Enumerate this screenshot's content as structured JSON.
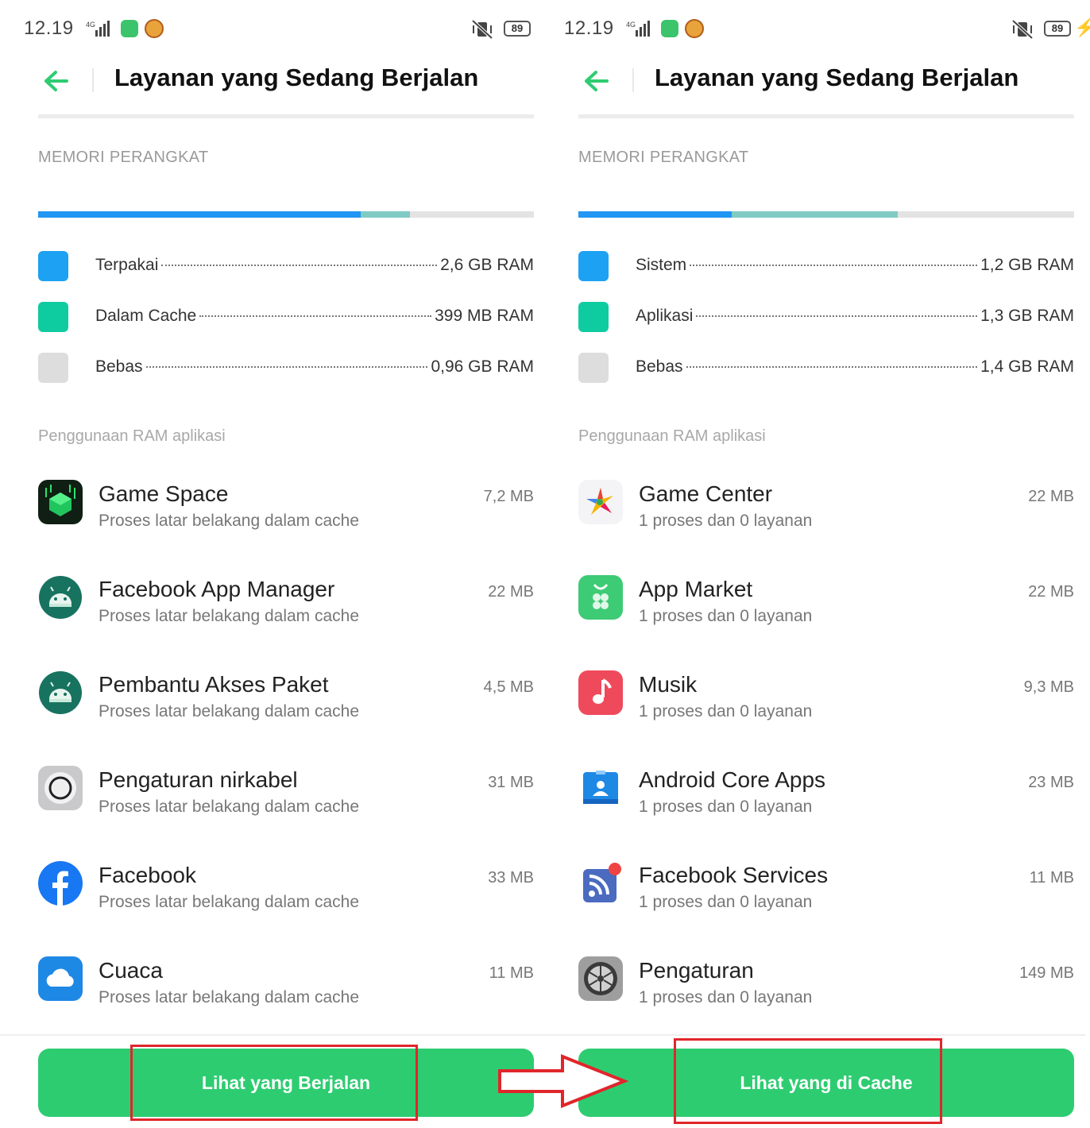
{
  "left": {
    "status": {
      "time": "12.19",
      "battery": "89"
    },
    "header": {
      "title": "Layanan yang Sedang Berjalan"
    },
    "memory_label": "MEMORI PERANGKAT",
    "memory_bar": [
      {
        "fraction": 0.65,
        "color": "#2196f3"
      },
      {
        "fraction": 0.1,
        "color": "#80cbc4"
      }
    ],
    "legend": [
      {
        "label": "Terpakai",
        "value": "2,6 GB RAM",
        "color": "#1da1f2"
      },
      {
        "label": "Dalam Cache",
        "value": "399 MB RAM",
        "color": "#0fcca0"
      },
      {
        "label": "Bebas",
        "value": "0,96 GB RAM",
        "color": "#dddddd"
      }
    ],
    "apps_label": "Penggunaan RAM aplikasi",
    "apps": [
      {
        "name": "Game Space",
        "desc": "Proses latar belakang dalam cache",
        "size": "7,2 MB",
        "icon": "game-space-icon"
      },
      {
        "name": "Facebook App Manager",
        "desc": "Proses latar belakang dalam cache",
        "size": "22 MB",
        "icon": "android-icon"
      },
      {
        "name": "Pembantu Akses Paket",
        "desc": "Proses latar belakang dalam cache",
        "size": "4,5 MB",
        "icon": "android-icon"
      },
      {
        "name": "Pengaturan nirkabel",
        "desc": "Proses latar belakang dalam cache",
        "size": "31 MB",
        "icon": "wireless-settings-icon"
      },
      {
        "name": "Facebook",
        "desc": "Proses latar belakang dalam cache",
        "size": "33 MB",
        "icon": "facebook-icon"
      },
      {
        "name": "Cuaca",
        "desc": "Proses latar belakang dalam cache",
        "size": "11 MB",
        "icon": "weather-icon"
      }
    ],
    "button": "Lihat yang Berjalan"
  },
  "right": {
    "status": {
      "time": "12.19",
      "battery": "89"
    },
    "header": {
      "title": "Layanan yang Sedang Berjalan"
    },
    "memory_label": "MEMORI PERANGKAT",
    "memory_bar": [
      {
        "fraction": 0.31,
        "color": "#2196f3"
      },
      {
        "fraction": 0.335,
        "color": "#80cbc4"
      }
    ],
    "legend": [
      {
        "label": "Sistem",
        "value": "1,2 GB RAM",
        "color": "#1da1f2"
      },
      {
        "label": "Aplikasi",
        "value": "1,3 GB RAM",
        "color": "#0fcca0"
      },
      {
        "label": "Bebas",
        "value": "1,4 GB RAM",
        "color": "#dddddd"
      }
    ],
    "apps_label": "Penggunaan RAM aplikasi",
    "apps": [
      {
        "name": "Game Center",
        "desc": "1 proses dan 0 layanan",
        "size": "22 MB",
        "icon": "game-center-icon"
      },
      {
        "name": "App Market",
        "desc": "1 proses dan 0 layanan",
        "size": "22 MB",
        "icon": "app-market-icon"
      },
      {
        "name": "Musik",
        "desc": "1 proses dan 0 layanan",
        "size": "9,3 MB",
        "icon": "music-icon"
      },
      {
        "name": "Android Core Apps",
        "desc": "1 proses dan 0 layanan",
        "size": "23 MB",
        "icon": "android-core-apps-icon"
      },
      {
        "name": "Facebook Services",
        "desc": "1 proses dan 0 layanan",
        "size": "11 MB",
        "icon": "facebook-services-icon"
      },
      {
        "name": "Pengaturan",
        "desc": "1 proses dan 0 layanan",
        "size": "149 MB",
        "icon": "settings-icon"
      }
    ],
    "button": "Lihat yang di Cache"
  },
  "colors": {
    "accent": "#2ecc71",
    "annotation": "#e0262b"
  }
}
